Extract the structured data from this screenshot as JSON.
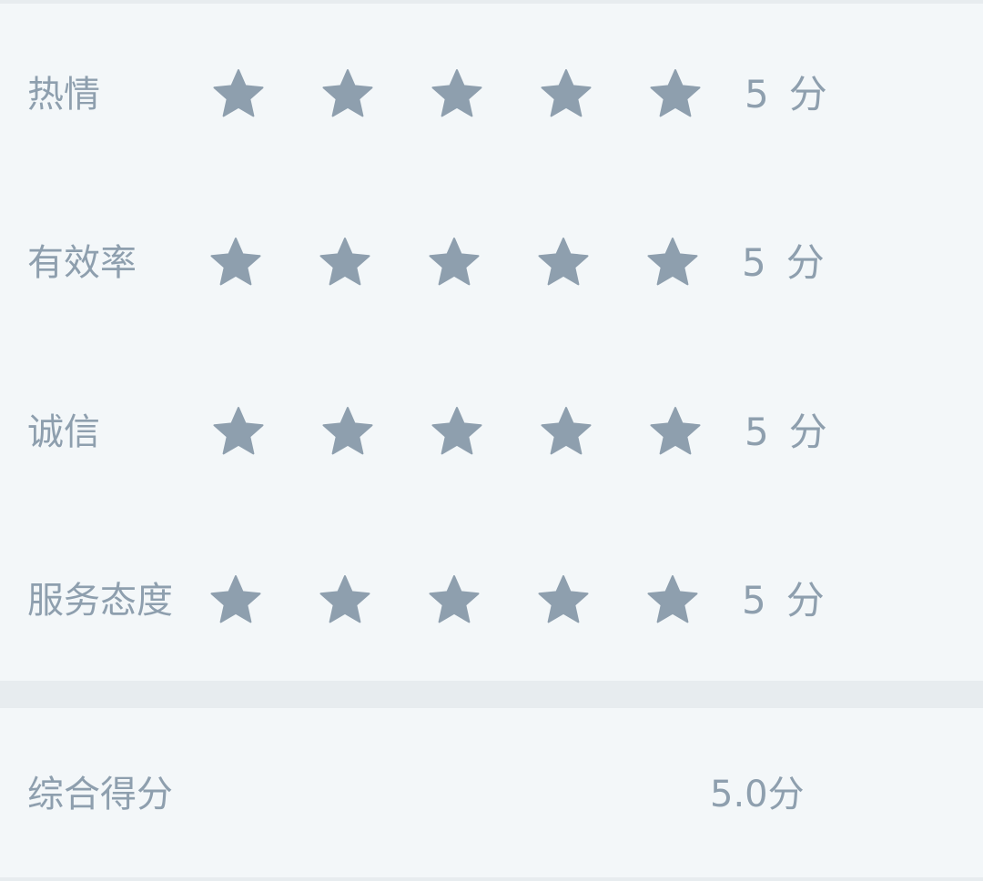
{
  "colors": {
    "background": "#f3f7f9",
    "divider": "#e7ecef",
    "text": "#8e9fae",
    "star_filled": "#8e9fae"
  },
  "ratings": [
    {
      "label": "热情",
      "stars_filled": 5,
      "stars_total": 5,
      "score": "5",
      "unit": "分"
    },
    {
      "label": "有效率",
      "stars_filled": 5,
      "stars_total": 5,
      "score": "5",
      "unit": "分"
    },
    {
      "label": "诚信",
      "stars_filled": 5,
      "stars_total": 5,
      "score": "5",
      "unit": "分"
    },
    {
      "label": "服务态度",
      "stars_filled": 5,
      "stars_total": 5,
      "score": "5",
      "unit": "分"
    }
  ],
  "total": {
    "label": "综合得分",
    "value": "5.0分"
  }
}
